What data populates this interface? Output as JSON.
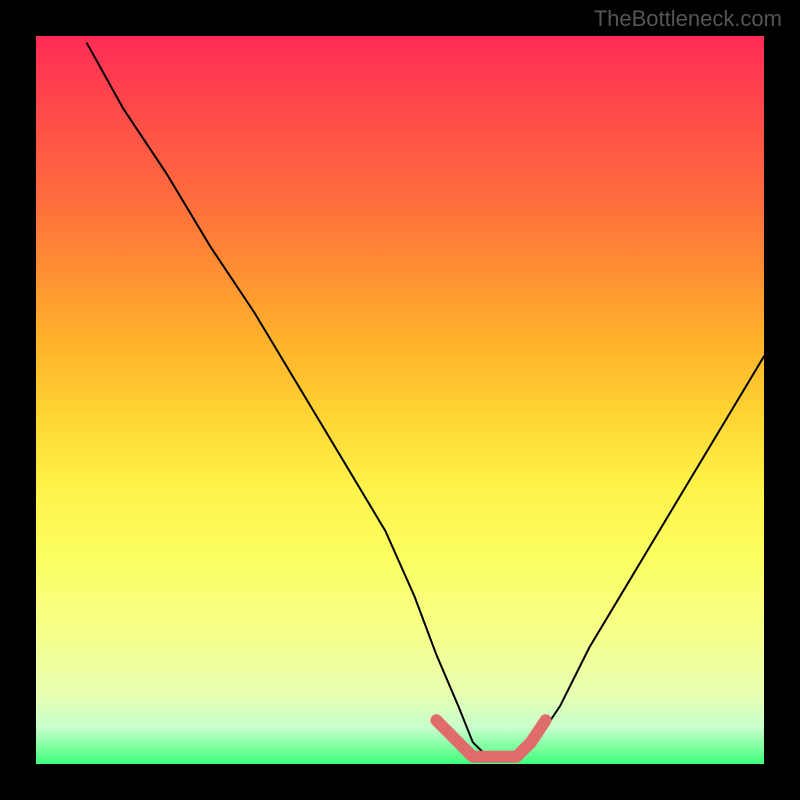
{
  "watermark": "TheBottleneck.com",
  "chart_data": {
    "type": "line",
    "title": "",
    "xlabel": "",
    "ylabel": "",
    "xlim": [
      0,
      100
    ],
    "ylim": [
      0,
      100
    ],
    "grid": false,
    "legend": false,
    "gradient_meaning": "background gradient red→yellow→green, green = optimal (low bottleneck), red = high bottleneck",
    "series": [
      {
        "name": "bottleneck-curve",
        "color": "#000000",
        "x": [
          7,
          12,
          18,
          24,
          30,
          36,
          42,
          48,
          52,
          55,
          58,
          60,
          62,
          64,
          66,
          68,
          72,
          76,
          82,
          88,
          94,
          100
        ],
        "y": [
          99,
          90,
          81,
          71,
          62,
          52,
          42,
          32,
          23,
          15,
          8,
          3,
          1,
          1,
          1,
          2,
          8,
          16,
          26,
          36,
          46,
          56
        ]
      },
      {
        "name": "optimal-band-marker",
        "color": "#e57373",
        "note": "thick coral segment marking the flat minimum region",
        "x": [
          55,
          58,
          60,
          62,
          64,
          66,
          68,
          70
        ],
        "y": [
          6,
          3,
          1,
          1,
          1,
          1,
          3,
          6
        ]
      }
    ]
  }
}
